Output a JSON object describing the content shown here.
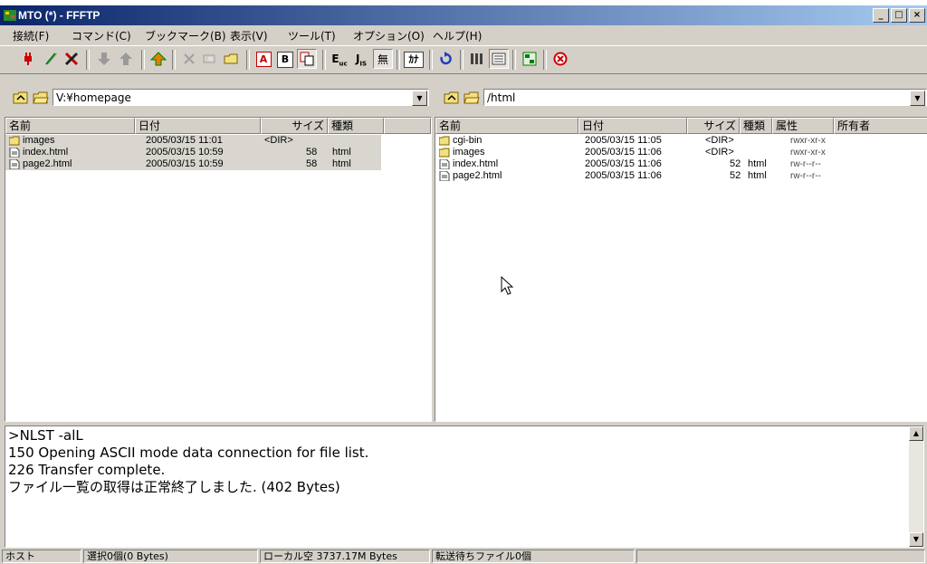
{
  "window": {
    "title": "MTO (*) - FFFTP"
  },
  "menu": [
    "接続(F)",
    "コマンド(C)",
    "ブックマーク(B)",
    "表示(V)",
    "ツール(T)",
    "オプション(O)",
    "ヘルプ(H)"
  ],
  "toolbar": {
    "ascii_label": "A",
    "binary_label": "B",
    "euc_label": "E",
    "jis_label": "J",
    "kana_label": "ｶﾅ",
    "none_label": "無"
  },
  "local": {
    "path": "V:¥homepage",
    "columns": {
      "name": "名前",
      "date": "日付",
      "size": "サイズ",
      "type": "種類"
    },
    "files": [
      {
        "name": "images",
        "date": "2005/03/15 11:01",
        "size": "<DIR>",
        "type": "",
        "icon": "folder-icon"
      },
      {
        "name": "index.html",
        "date": "2005/03/15 10:59",
        "size": "58",
        "type": "html",
        "icon": "file-icon"
      },
      {
        "name": "page2.html",
        "date": "2005/03/15 10:59",
        "size": "58",
        "type": "html",
        "icon": "file-icon"
      }
    ]
  },
  "remote": {
    "path": "/html",
    "columns": {
      "name": "名前",
      "date": "日付",
      "size": "サイズ",
      "type": "種類",
      "attr": "属性",
      "owner": "所有者"
    },
    "files": [
      {
        "name": "cgi-bin",
        "date": "2005/03/15 11:05",
        "size": "<DIR>",
        "type": "",
        "attr": "rwxr-xr-x",
        "icon": "folder-icon"
      },
      {
        "name": "images",
        "date": "2005/03/15 11:06",
        "size": "<DIR>",
        "type": "",
        "attr": "rwxr-xr-x",
        "icon": "folder-icon"
      },
      {
        "name": "index.html",
        "date": "2005/03/15 11:06",
        "size": "52",
        "type": "html",
        "attr": "rw-r--r--",
        "icon": "file-icon"
      },
      {
        "name": "page2.html",
        "date": "2005/03/15 11:06",
        "size": "52",
        "type": "html",
        "attr": "rw-r--r--",
        "icon": "file-icon"
      }
    ]
  },
  "log": [
    ">NLST -alL",
    "150 Opening ASCII mode data connection for file list.",
    "226 Transfer complete.",
    "ファイル一覧の取得は正常終了しました. (402 Bytes)"
  ],
  "status": {
    "host": "ホスト",
    "selection": "選択0個(0 Bytes)",
    "local_free": "ローカル空 3737.17M Bytes",
    "queue": "転送待ちファイル0個"
  },
  "colors": {
    "title_start": "#0a246a",
    "title_end": "#a6caf0",
    "face": "#d4d0c8",
    "selection_bg": "#d9d6d0"
  }
}
